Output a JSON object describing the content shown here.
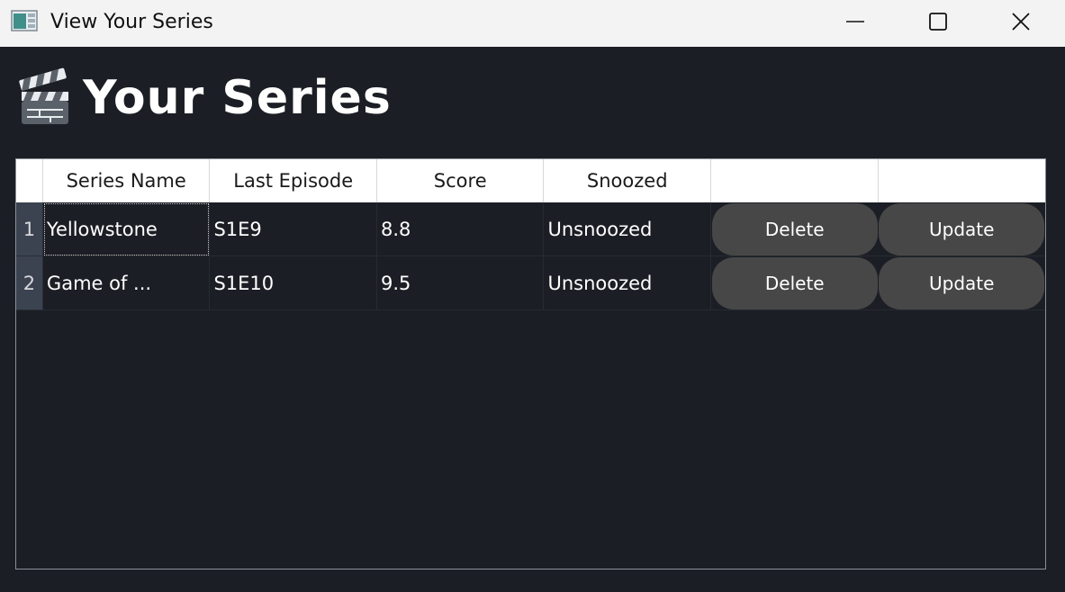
{
  "window": {
    "title": "View Your Series"
  },
  "header": {
    "title": "Your Series"
  },
  "table": {
    "columns": [
      "Series Name",
      "Last Episode",
      "Score",
      "Snoozed",
      "",
      ""
    ],
    "rows": [
      {
        "index": "1",
        "series_name": "Yellowstone",
        "last_episode": "S1E9",
        "score": "8.8",
        "snoozed": "Unsnoozed",
        "delete_label": "Delete",
        "update_label": "Update"
      },
      {
        "index": "2",
        "series_name": "Game of ...",
        "last_episode": "S1E10",
        "score": "9.5",
        "snoozed": "Unsnoozed",
        "delete_label": "Delete",
        "update_label": "Update"
      }
    ]
  },
  "icons": {
    "app": "app-window-icon",
    "header": "clapperboard-icon",
    "minimize": "minimize-icon",
    "maximize": "maximize-icon",
    "close": "close-icon"
  },
  "colors": {
    "background": "#1b1e25",
    "button": "#474747",
    "header_row": "#ffffff",
    "row_number": "#3c4350"
  }
}
